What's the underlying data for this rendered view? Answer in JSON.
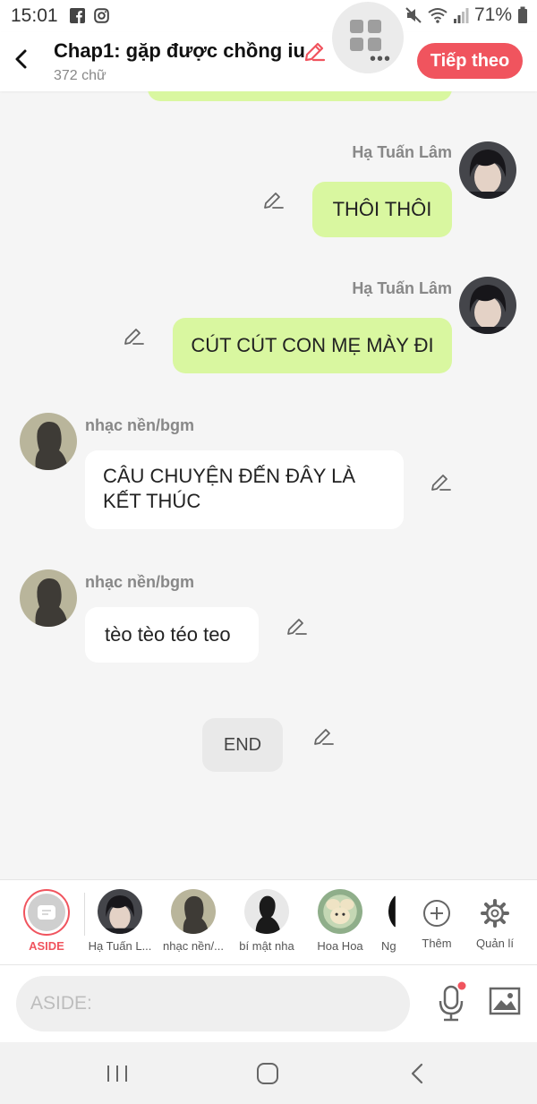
{
  "status_bar": {
    "time": "15:01",
    "battery": "71%"
  },
  "header": {
    "title": "Chap1: gặp được chồng iu",
    "word_count": "372 chữ",
    "next_label": "Tiếp theo"
  },
  "messages": [
    {
      "sender": "Hạ Tuấn Lâm",
      "text": "THÔI THÔI"
    },
    {
      "sender": "Hạ Tuấn Lâm",
      "text": "CÚT CÚT CON MẸ MÀY ĐI"
    },
    {
      "sender": "nhạc nền/bgm",
      "text": "CÂU CHUYỆN ĐẾN ĐÂY LÀ KẾT THÚC"
    },
    {
      "sender": "nhạc nền/bgm",
      "text": "tèo tèo téo teo"
    }
  ],
  "end_label": "END",
  "characters": {
    "aside": "ASIDE",
    "items": [
      {
        "name": "Hạ Tuấn L..."
      },
      {
        "name": "nhạc nền/..."
      },
      {
        "name": "bí mật nha"
      },
      {
        "name": "Hoa Hoa"
      },
      {
        "name": "Ng"
      }
    ],
    "add_label": "Thêm",
    "manage_label": "Quản lí"
  },
  "input": {
    "placeholder": "ASIDE:"
  },
  "colors": {
    "accent": "#f0545e",
    "green_bubble": "#d9f7a0"
  }
}
